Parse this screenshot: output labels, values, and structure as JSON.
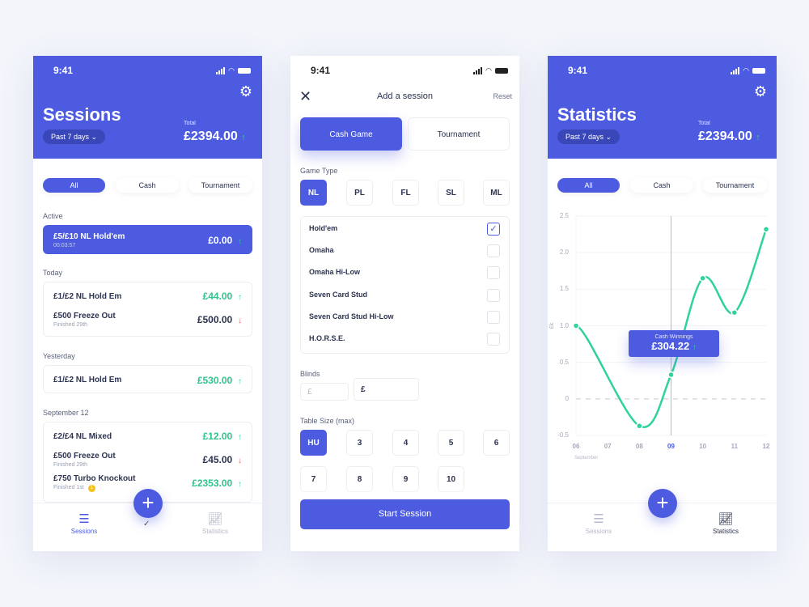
{
  "status": {
    "time": "9:41"
  },
  "sessions": {
    "title": "Sessions",
    "range": "Past 7 days",
    "total_label": "Total",
    "total": "£2394.00",
    "total_trend": "↑",
    "filters": [
      "All",
      "Cash",
      "Tournament"
    ],
    "active_filter": "All",
    "groups": [
      {
        "label": "Active",
        "items": [
          {
            "name": "£5/£10 NL Hold'em",
            "sub": "00:03:57",
            "value": "£0.00",
            "trend": "up",
            "active": true
          }
        ]
      },
      {
        "label": "Today",
        "items": [
          {
            "name": "£1/£2 NL Hold Em",
            "sub": "",
            "value": "£44.00",
            "trend": "up"
          },
          {
            "name": "£500 Freeze Out",
            "sub": "Finished 29th",
            "value": "£500.00",
            "trend": "down"
          }
        ]
      },
      {
        "label": "Yesterday",
        "items": [
          {
            "name": "£1/£2 NL Hold Em",
            "sub": "",
            "value": "£530.00",
            "trend": "up"
          }
        ]
      },
      {
        "label": "September 12",
        "items": [
          {
            "name": "£2/£4 NL Mixed",
            "sub": "",
            "value": "£12.00",
            "trend": "up"
          },
          {
            "name": "£500 Freeze Out",
            "sub": "Finished 29th",
            "value": "£45.00",
            "trend": "down"
          },
          {
            "name": "£750 Turbo Knockout",
            "sub": "Finished 1st",
            "badge": "1",
            "value": "£2353.00",
            "trend": "up"
          }
        ]
      }
    ]
  },
  "nav": {
    "sessions": "Sessions",
    "statistics": "Statistics",
    "add": "+"
  },
  "add_session": {
    "title": "Add a session",
    "reset": "Reset",
    "modes": [
      "Cash Game",
      "Tournament"
    ],
    "active_mode": "Cash Game",
    "game_type_label": "Game Type",
    "limits": [
      "NL",
      "PL",
      "FL",
      "SL",
      "ML"
    ],
    "active_limit": "NL",
    "games": [
      {
        "name": "Hold'em",
        "checked": true
      },
      {
        "name": "Omaha",
        "checked": false
      },
      {
        "name": "Omaha Hi-Low",
        "checked": false
      },
      {
        "name": "Seven Card Stud",
        "checked": false
      },
      {
        "name": "Seven Card Stud Hi-Low",
        "checked": false
      },
      {
        "name": "H.O.R.S.E.",
        "checked": false
      }
    ],
    "blinds_label": "Blinds",
    "blind_small_placeholder": "£",
    "blind_big_value": "£",
    "table_size_label": "Table Size (max)",
    "table_sizes": [
      "HU",
      "3",
      "4",
      "5",
      "6",
      "7",
      "8",
      "9",
      "10"
    ],
    "active_size": "HU",
    "start": "Start Session"
  },
  "statistics": {
    "title": "Statistics",
    "range": "Past 7 days",
    "total_label": "Total",
    "total": "£2394.00",
    "total_trend": "↑",
    "filters": [
      "All",
      "Cash",
      "Tournament"
    ],
    "active_filter": "All",
    "tooltip": {
      "label": "Cash Winnings",
      "value": "£304.22",
      "trend": "↑"
    }
  },
  "colors": {
    "primary": "#4c5be0",
    "up": "#2fd39a",
    "down": "#e25b5b"
  },
  "chart_data": {
    "type": "line",
    "ylabel": "£k",
    "xlabel": "September",
    "x": [
      "06",
      "07",
      "08",
      "09",
      "10",
      "11",
      "12"
    ],
    "points": [
      {
        "x": "06",
        "y": 1.0
      },
      {
        "x": "08",
        "y": -0.37
      },
      {
        "x": "09",
        "y": 0.33
      },
      {
        "x": "10",
        "y": 1.65
      },
      {
        "x": "11",
        "y": 1.18
      },
      {
        "x": "12",
        "y": 2.32
      }
    ],
    "yticks": [
      "2.5",
      "2.0",
      "1.5",
      "1.0",
      "0.5",
      "0",
      "-0.5"
    ],
    "ylim": [
      -0.5,
      2.5
    ],
    "highlight_x": "09",
    "zero_line": "dashed",
    "grid": true,
    "color": "#2fd39a"
  }
}
